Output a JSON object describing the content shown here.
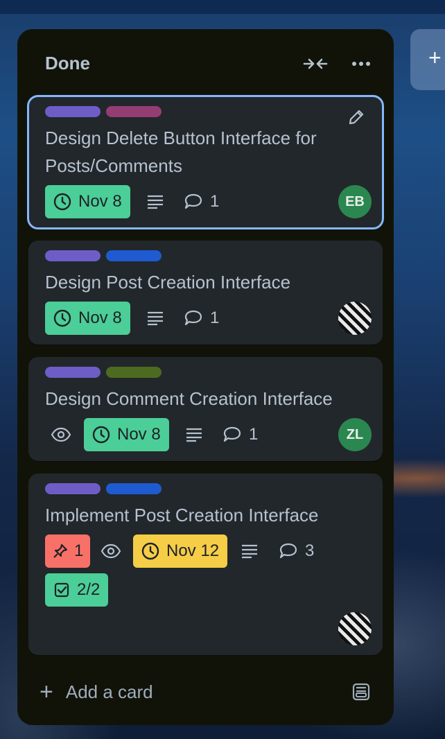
{
  "list": {
    "title": "Done",
    "add_card_label": "Add a card",
    "add_card_icon": "plus-icon",
    "collapse_icon": "collapse-arrows-icon",
    "menu_icon": "more-horizontal-icon",
    "template_icon": "card-template-icon"
  },
  "ghost_list": {
    "icon": "plus-icon",
    "glyph": "+"
  },
  "colors": {
    "list_bg": "#111309",
    "card_bg": "#22272b",
    "text": "#b6c2cf",
    "selected_outline": "#85b8ff",
    "label_purple": "#6e5dc6",
    "label_magenta": "#943d73",
    "label_blue": "#1f5bd0",
    "label_olive": "#4c6b1f",
    "badge_green": "#4bce97",
    "badge_yellow": "#f5cd47",
    "badge_red": "#f87168",
    "avatar_green": "#2b8750"
  },
  "cards": [
    {
      "title": "Design Delete Button Interface for Posts/Comments",
      "labels": [
        "purple",
        "magenta"
      ],
      "due": "Nov 8",
      "has_description": true,
      "comments": "1",
      "avatar": "EB",
      "selected": true
    },
    {
      "title": "Design Post Creation Interface",
      "labels": [
        "purple",
        "blue"
      ],
      "due": "Nov 8",
      "has_description": true,
      "comments": "1",
      "avatar": "photo"
    },
    {
      "title": "Design Comment Creation Interface",
      "labels": [
        "purple",
        "olive"
      ],
      "watching": true,
      "due": "Nov 8",
      "has_description": true,
      "comments": "1",
      "avatar": "ZL"
    },
    {
      "title": "Implement Post Creation Interface",
      "labels": [
        "purple",
        "blue"
      ],
      "priority": "1",
      "watching": true,
      "due": "Nov 12",
      "has_description": true,
      "comments": "3",
      "checklist": "2/2",
      "avatar": "photo"
    }
  ]
}
